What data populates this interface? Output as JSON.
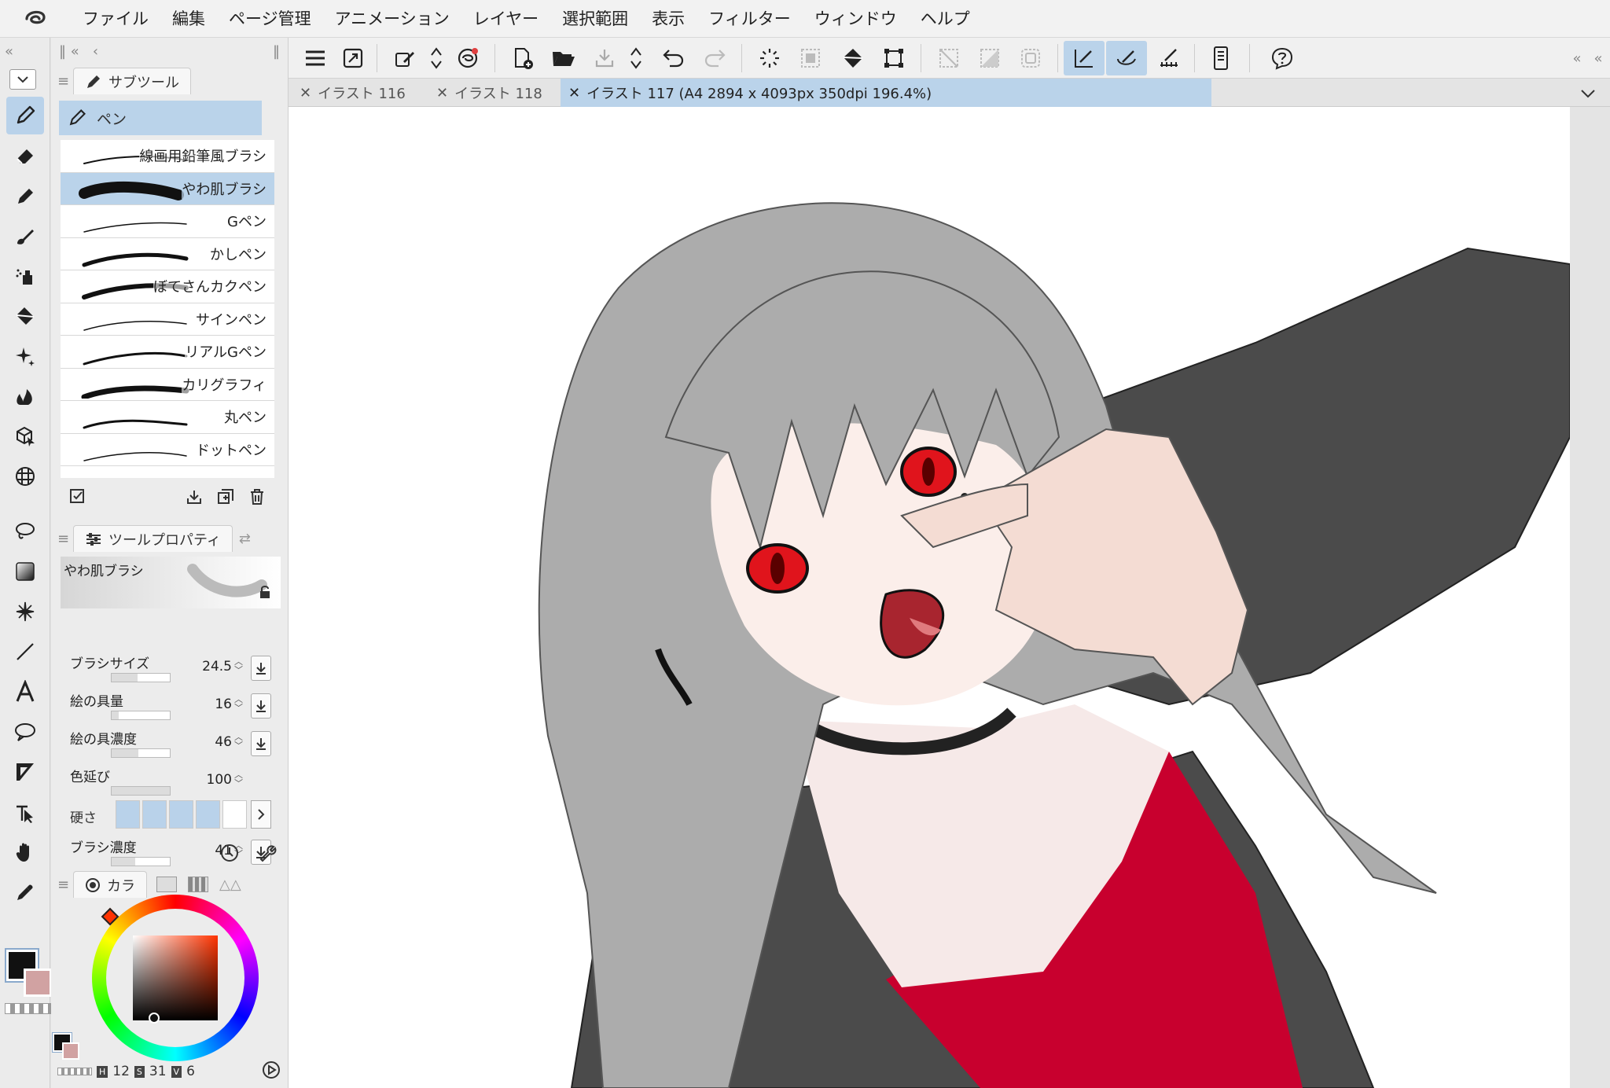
{
  "menu": [
    "ファイル",
    "編集",
    "ページ管理",
    "アニメーション",
    "レイヤー",
    "選択範囲",
    "表示",
    "フィルター",
    "ウィンドウ",
    "ヘルプ"
  ],
  "subtool": {
    "tab_label": "サブツール",
    "group": "ペン",
    "brushes": [
      {
        "label": "線画用鉛筆風ブラシ",
        "active": false
      },
      {
        "label": "やわ肌ブラシ",
        "active": true
      },
      {
        "label": "Gペン",
        "active": false
      },
      {
        "label": "かしペン",
        "active": false
      },
      {
        "label": "ぼてさんカクペン",
        "active": false
      },
      {
        "label": "サインペン",
        "active": false
      },
      {
        "label": "リアルGペン",
        "active": false
      },
      {
        "label": "カリグラフィ",
        "active": false
      },
      {
        "label": "丸ペン",
        "active": false
      },
      {
        "label": "ドットペン",
        "active": false
      }
    ]
  },
  "tool_property": {
    "tab_label": "ツールプロパティ",
    "brush_name": "やわ肌ブラシ",
    "rows": [
      {
        "label": "ブラシサイズ",
        "value": "24.5",
        "level": 0.45
      },
      {
        "label": "絵の具量",
        "value": "16",
        "level": 0.12
      },
      {
        "label": "絵の具濃度",
        "value": "46",
        "level": 0.46
      },
      {
        "label": "色延び",
        "value": "100",
        "level": 1.0
      },
      {
        "label": "ブラシ濃度",
        "value": "41",
        "level": 0.41
      }
    ],
    "hardness_label": "硬さ",
    "hardness_level": 4
  },
  "color": {
    "tab_label": "カラ",
    "main_color": "#111111",
    "sub_color": "#d1a2a2",
    "h_key": "H",
    "h": "12",
    "s_key": "S",
    "s": "31",
    "v_key": "V",
    "v": "6"
  },
  "tabs": [
    {
      "label": "イラスト 116",
      "active": false
    },
    {
      "label": "イラスト 118",
      "active": false
    },
    {
      "label": "イラスト 117 (A4 2894 x 4093px 350dpi 196.4%)",
      "active": true
    }
  ],
  "accent": "#bad3ea"
}
